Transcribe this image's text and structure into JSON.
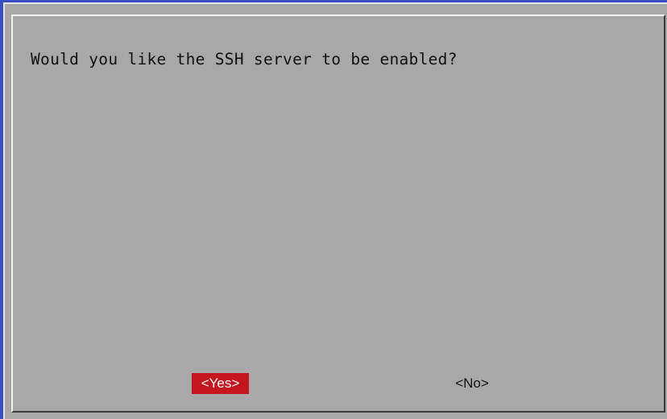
{
  "dialog": {
    "message": "Would you like the SSH server to be enabled?",
    "buttons": {
      "yes_label": "<Yes>",
      "no_label": "<No>"
    },
    "selected_button": "yes"
  },
  "colors": {
    "screen_background": "#3b4fc4",
    "dialog_background": "#a8a8a8",
    "selected_button_background": "#c4161c",
    "selected_button_text": "#ffffff",
    "text": "#111111"
  }
}
